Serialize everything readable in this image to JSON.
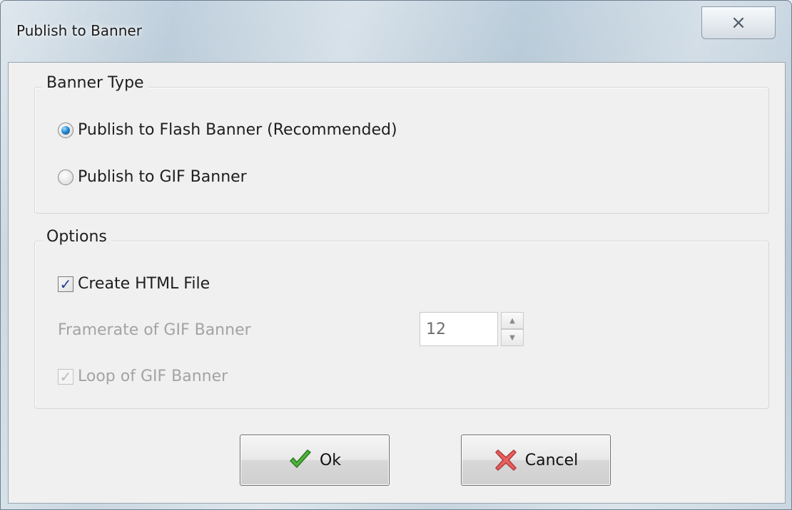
{
  "window": {
    "title": "Publish to Banner",
    "close_symbol": "⨯"
  },
  "banner_type": {
    "title": "Banner Type",
    "options": [
      {
        "label": "Publish to Flash Banner (Recommended)",
        "selected": true
      },
      {
        "label": "Publish to GIF Banner",
        "selected": false
      }
    ]
  },
  "options": {
    "title": "Options",
    "create_html": {
      "label": "Create HTML File",
      "checked": true,
      "check_mark": "✓"
    },
    "framerate": {
      "label": "Framerate of GIF Banner",
      "value": "12"
    },
    "loop": {
      "label": "Loop of GIF Banner",
      "checked": true,
      "check_mark": "✓"
    }
  },
  "buttons": {
    "ok": {
      "label": "Ok",
      "icon": "checkmark-icon"
    },
    "cancel": {
      "label": "Cancel",
      "icon": "x-icon"
    }
  },
  "colors": {
    "accent": "#2a8ad4",
    "check": "#213a8f",
    "disabled": "#a3a3a3"
  }
}
